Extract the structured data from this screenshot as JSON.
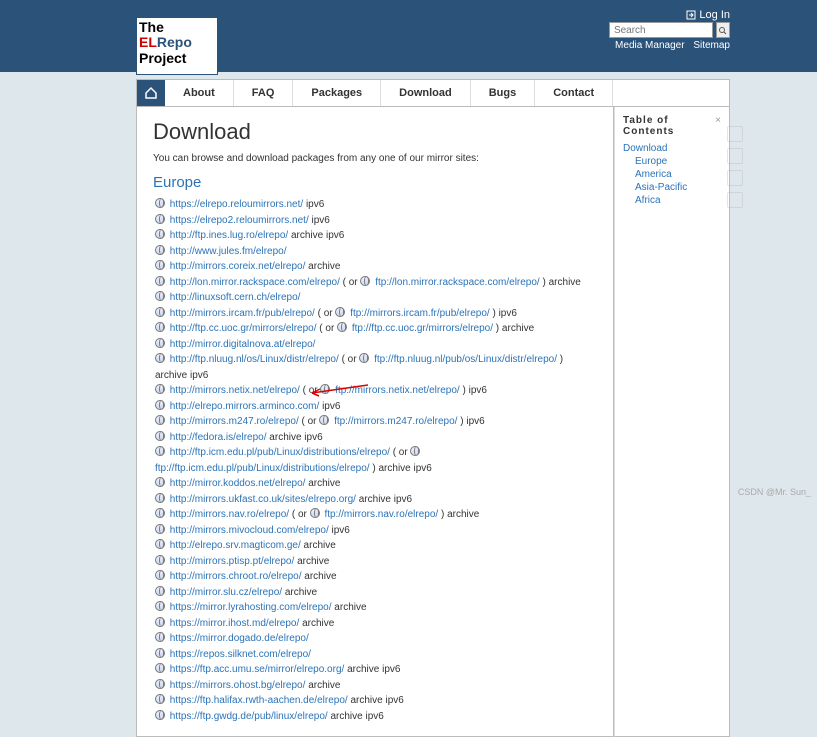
{
  "header": {
    "logo_l1": "The",
    "logo_l2a": "EL",
    "logo_l2b": "Repo",
    "logo_l3": "Project",
    "login": "Log In",
    "search_placeholder": "Search",
    "media_manager": "Media Manager",
    "sitemap": "Sitemap"
  },
  "nav": {
    "about": "About",
    "faq": "FAQ",
    "packages": "Packages",
    "download": "Download",
    "bugs": "Bugs",
    "contact": "Contact"
  },
  "page": {
    "title": "Download",
    "intro": "You can browse and download packages from any one of our mirror sites:",
    "section": "Europe"
  },
  "mirrors": [
    {
      "url": "https://elrepo.reloumirrors.net/",
      "note": "ipv6"
    },
    {
      "url": "https://elrepo2.reloumirrors.net/",
      "note": "ipv6"
    },
    {
      "url": "http://ftp.ines.lug.ro/elrepo/",
      "note": "archive ipv6"
    },
    {
      "url": "http://www.jules.fm/elrepo/",
      "note": ""
    },
    {
      "url": "http://mirrors.coreix.net/elrepo/",
      "note": "archive"
    },
    {
      "url": "http://lon.mirror.rackspace.com/elrepo/",
      "paren": true,
      "alt": "ftp://lon.mirror.rackspace.com/elrepo/",
      "note": "archive"
    },
    {
      "url": "http://linuxsoft.cern.ch/elrepo/",
      "note": ""
    },
    {
      "url": "http://mirrors.ircam.fr/pub/elrepo/",
      "paren": true,
      "alt": "ftp://mirrors.ircam.fr/pub/elrepo/",
      "note": "ipv6"
    },
    {
      "url": "http://ftp.cc.uoc.gr/mirrors/elrepo/",
      "paren": true,
      "alt": "ftp://ftp.cc.uoc.gr/mirrors/elrepo/",
      "note": "archive"
    },
    {
      "url": "http://mirror.digitalnova.at/elrepo/",
      "note": ""
    },
    {
      "url": "http://ftp.nluug.nl/os/Linux/distr/elrepo/",
      "paren": true,
      "alt": "ftp://ftp.nluug.nl/pub/os/Linux/distr/elrepo/",
      "note": "archive ipv6"
    },
    {
      "url": "http://mirrors.netix.net/elrepo/",
      "paren_or": true,
      "alt": "ftp://mirrors.netix.net/elrepo/",
      "note": "ipv6"
    },
    {
      "url": "http://elrepo.mirrors.arminco.com/",
      "note": "ipv6"
    },
    {
      "url": "http://mirrors.m247.ro/elrepo/",
      "paren": true,
      "alt": "ftp://mirrors.m247.ro/elrepo/",
      "note": "ipv6"
    },
    {
      "url": "http://fedora.is/elrepo/",
      "note": "archive ipv6"
    },
    {
      "url": "http://ftp.icm.edu.pl/pub/Linux/distributions/elrepo/",
      "paren": true,
      "alt": "ftp://ftp.icm.edu.pl/pub/Linux/distributions/elrepo/",
      "note": "archive ipv6"
    },
    {
      "url": "http://mirror.koddos.net/elrepo/",
      "note": "archive"
    },
    {
      "url": "http://mirrors.ukfast.co.uk/sites/elrepo.org/",
      "note": "archive ipv6"
    },
    {
      "url": "http://mirrors.nav.ro/elrepo/",
      "paren_or": true,
      "alt": "ftp://mirrors.nav.ro/elrepo/",
      "note": "archive"
    },
    {
      "url": "http://mirrors.mivocloud.com/elrepo/",
      "note": "ipv6"
    },
    {
      "url": "http://elrepo.srv.magticom.ge/",
      "note": "archive",
      "hl": true
    },
    {
      "url": "http://mirrors.ptisp.pt/elrepo/",
      "note": "archive"
    },
    {
      "url": "http://mirrors.chroot.ro/elrepo/",
      "note": "archive"
    },
    {
      "url": "http://mirror.slu.cz/elrepo/",
      "note": "archive"
    },
    {
      "url": "https://mirror.lyrahosting.com/elrepo/",
      "note": "archive"
    },
    {
      "url": "https://mirror.ihost.md/elrepo/",
      "note": "archive"
    },
    {
      "url": "https://mirror.dogado.de/elrepo/",
      "note": ""
    },
    {
      "url": "https://repos.silknet.com/elrepo/",
      "note": ""
    },
    {
      "url": "https://ftp.acc.umu.se/mirror/elrepo.org/",
      "note": "archive ipv6"
    },
    {
      "url": "https://mirrors.ohost.bg/elrepo/",
      "note": "archive"
    },
    {
      "url": "https://ftp.halifax.rwth-aachen.de/elrepo/",
      "note": "archive ipv6"
    },
    {
      "url": "https://ftp.gwdg.de/pub/linux/elrepo/",
      "note": "archive ipv6"
    }
  ],
  "toc": {
    "title": "Table of Contents",
    "items": [
      "Download"
    ],
    "sub": [
      "Europe",
      "America",
      "Asia-Pacific",
      "Africa"
    ]
  },
  "watermark": "CSDN @Mr. Sun_"
}
